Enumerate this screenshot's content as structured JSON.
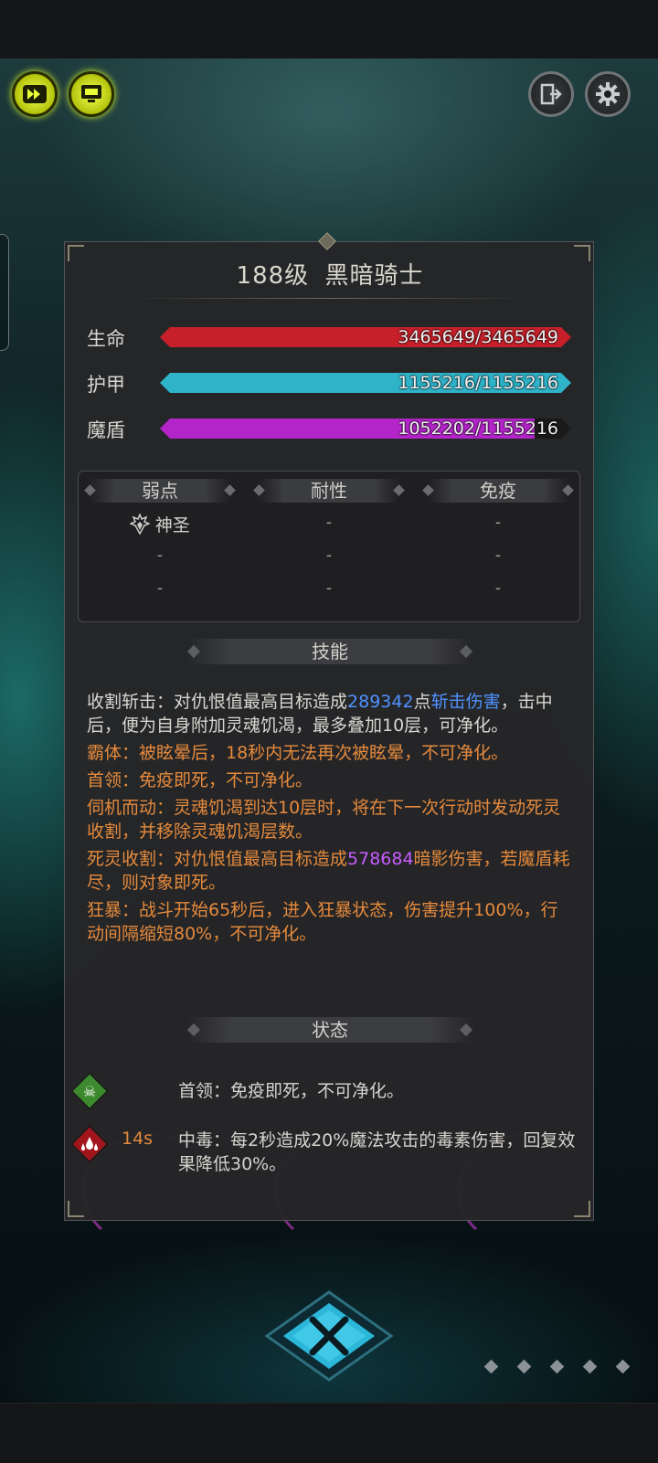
{
  "header": {
    "title_level": "188级",
    "title_name": "黑暗骑士"
  },
  "icons": {
    "fast_forward": "fast-forward-icon",
    "auto_battle": "monitor-icon",
    "exit": "exit-door-icon",
    "settings": "gear-icon",
    "close": "crossed-swords-icon"
  },
  "stats": {
    "hp_label": "生命",
    "hp_value": "3465649/3465649",
    "hp_fill": 1.0,
    "hp_color": "#c8202a",
    "armor_label": "护甲",
    "armor_value": "1155216/1155216",
    "armor_fill": 1.0,
    "armor_color": "#2fb3c9",
    "shield_label": "魔盾",
    "shield_value": "1052202/1155216",
    "shield_fill": 0.911,
    "shield_color": "#b325c9"
  },
  "resistances": {
    "weakness_label": "弱点",
    "resistance_label": "耐性",
    "immunity_label": "免疫",
    "weakness": [
      "神圣",
      "-",
      "-"
    ],
    "resistance": [
      "-",
      "-",
      "-"
    ],
    "immunity": [
      "-",
      "-",
      "-"
    ]
  },
  "skills": {
    "section_label": "技能",
    "s1_name": "收割斩击：",
    "s1_a": "对仇恨值最高目标造成",
    "s1_num": "289342",
    "s1_b": "点",
    "s1_dmg": "斩击伤害",
    "s1_c": "，击中后，便为自身附加灵魂饥渴，最多叠加10层，可净化。",
    "s2": "霸体：被眩晕后，18秒内无法再次被眩晕，不可净化。",
    "s3": "首领：免疫即死，不可净化。",
    "s4": "伺机而动：灵魂饥渴到达10层时，将在下一次行动时发动死灵收割，并移除灵魂饥渴层数。",
    "s5_a": "死灵收割：对仇恨值最高目标造成",
    "s5_num": "578684",
    "s5_b": "暗影伤害，若魔盾耗尽，则对象即死。",
    "s6": "狂暴：战斗开始65秒后，进入狂暴状态，伤害提升100%，行动间隔缩短80%，不可净化。"
  },
  "status": {
    "section_label": "状态",
    "st1_text": "首领：免疫即死，不可净化。",
    "st1_icon": "skull-icon",
    "st2_time": "14s",
    "st2_text": "中毒：每2秒造成20%魔法攻击的毒素伤害，回复效果降低30%。",
    "st2_icon": "poison-drops-icon"
  },
  "pager": {
    "pages": 5
  }
}
